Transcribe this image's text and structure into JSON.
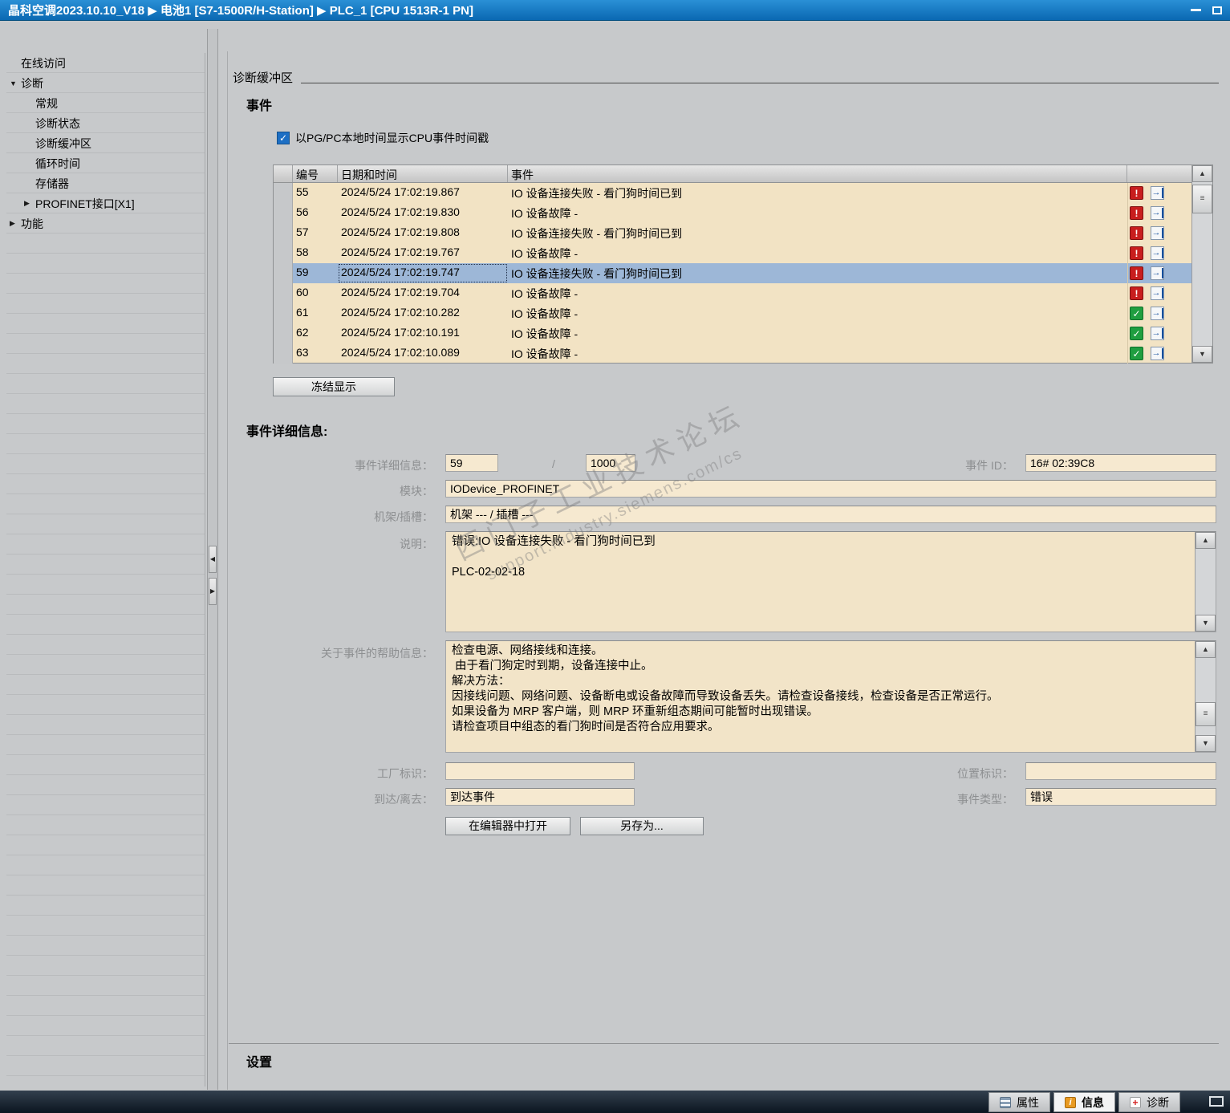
{
  "title_bar": {
    "title": "晶科空调2023.10.10_V18  ▶  电池1 [S7-1500R/H-Station]  ▶  PLC_1 [CPU 1513R-1 PN]"
  },
  "sidebar": {
    "items": [
      {
        "label": "在线访问",
        "arrow": ""
      },
      {
        "label": "诊断",
        "arrow": "▼"
      },
      {
        "label": "常规",
        "arrow": ""
      },
      {
        "label": "诊断状态",
        "arrow": ""
      },
      {
        "label": "诊断缓冲区",
        "arrow": ""
      },
      {
        "label": "循环时间",
        "arrow": ""
      },
      {
        "label": "存储器",
        "arrow": ""
      },
      {
        "label": "PROFINET接口[X1]",
        "arrow": "▶"
      },
      {
        "label": "功能",
        "arrow": "▶"
      }
    ]
  },
  "main": {
    "page_title": "诊断缓冲区",
    "events": {
      "heading": "事件",
      "timestamp_checkbox_label": "以PG/PC本地时间显示CPU事件时间戳",
      "checkbox_checked": true,
      "freeze_button": "冻结显示",
      "table": {
        "columns": {
          "no": "编号",
          "datetime": "日期和时间",
          "event": "事件"
        },
        "rows": [
          {
            "no": "55",
            "datetime": "2024/5/24 17:02:19.867",
            "event": "IO 设备连接失败 - 看门狗时间已到",
            "status": "error",
            "row_class": "evt-row",
            "icon_class": "st-icon error"
          },
          {
            "no": "56",
            "datetime": "2024/5/24 17:02:19.830",
            "event": "IO 设备故障 -",
            "status": "error",
            "row_class": "evt-row",
            "icon_class": "st-icon error"
          },
          {
            "no": "57",
            "datetime": "2024/5/24 17:02:19.808",
            "event": "IO 设备连接失败 - 看门狗时间已到",
            "status": "error",
            "row_class": "evt-row",
            "icon_class": "st-icon error"
          },
          {
            "no": "58",
            "datetime": "2024/5/24 17:02:19.767",
            "event": "IO 设备故障 -",
            "status": "error",
            "row_class": "evt-row",
            "icon_class": "st-icon error"
          },
          {
            "no": "59",
            "datetime": "2024/5/24 17:02:19.747",
            "event": "IO 设备连接失败 - 看门狗时间已到",
            "status": "error",
            "row_class": "evt-row selected",
            "icon_class": "st-icon error"
          },
          {
            "no": "60",
            "datetime": "2024/5/24 17:02:19.704",
            "event": "IO 设备故障 -",
            "status": "error",
            "row_class": "evt-row",
            "icon_class": "st-icon error"
          },
          {
            "no": "61",
            "datetime": "2024/5/24 17:02:10.282",
            "event": "IO 设备故障 -",
            "status": "ok",
            "row_class": "evt-row",
            "icon_class": "st-icon ok"
          },
          {
            "no": "62",
            "datetime": "2024/5/24 17:02:10.191",
            "event": "IO 设备故障 -",
            "status": "ok",
            "row_class": "evt-row",
            "icon_class": "st-icon ok"
          },
          {
            "no": "63",
            "datetime": "2024/5/24 17:02:10.089",
            "event": "IO 设备故障 -",
            "status": "ok",
            "row_class": "evt-row",
            "icon_class": "st-icon ok"
          }
        ]
      }
    },
    "details": {
      "heading": "事件详细信息:",
      "labels": {
        "detail_no": "事件详细信息：",
        "module": "模块：",
        "rack_slot": "机架/插槽：",
        "description": "说明：",
        "help": "关于事件的帮助信息：",
        "plant": "工厂标识：",
        "arrive": "到达/离去：",
        "event_id": "事件 ID：",
        "location": "位置标识：",
        "event_type": "事件类型："
      },
      "values": {
        "detail_no": "59",
        "detail_sep": "/",
        "detail_total": "1000",
        "event_id": "16# 02:39C8",
        "module": "IODevice_PROFINET",
        "rack_slot": "机架 --- / 插槽 ---",
        "description": "错误:IO 设备连接失败 - 看门狗时间已到\n\nPLC-02-02-18",
        "help": "检查电源、网络接线和连接。\n 由于看门狗定时到期，设备连接中止。\n解决方法：\n因接线问题、网络问题、设备断电或设备故障而导致设备丢失。请检查设备接线，检查设备是否正常运行。\n如果设备为 MRP 客户端，则 MRP 环重新组态期间可能暂时出现错误。\n请检查项目中组态的看门狗时间是否符合应用要求。",
        "plant": "",
        "location": "",
        "arrive": "到达事件",
        "event_type": "错误"
      },
      "open_button": "在编辑器中打开",
      "saveas_button": "另存为..."
    },
    "settings_heading": "设置"
  },
  "watermark": {
    "line1": "西门子工业技术论坛",
    "line2": "support.industry.siemens.com/cs"
  },
  "bottom_bar": {
    "tabs": [
      {
        "label": "属性",
        "active": false
      },
      {
        "label": "信息",
        "active": true
      },
      {
        "label": "诊断",
        "active": false
      }
    ]
  },
  "colors": {
    "titlebar_blue": "#0a68b2",
    "row_beige": "#f2e3c4",
    "selected_row_blue": "#9db7d7",
    "error_red": "#c81e1e",
    "ok_green": "#1f9e40"
  }
}
